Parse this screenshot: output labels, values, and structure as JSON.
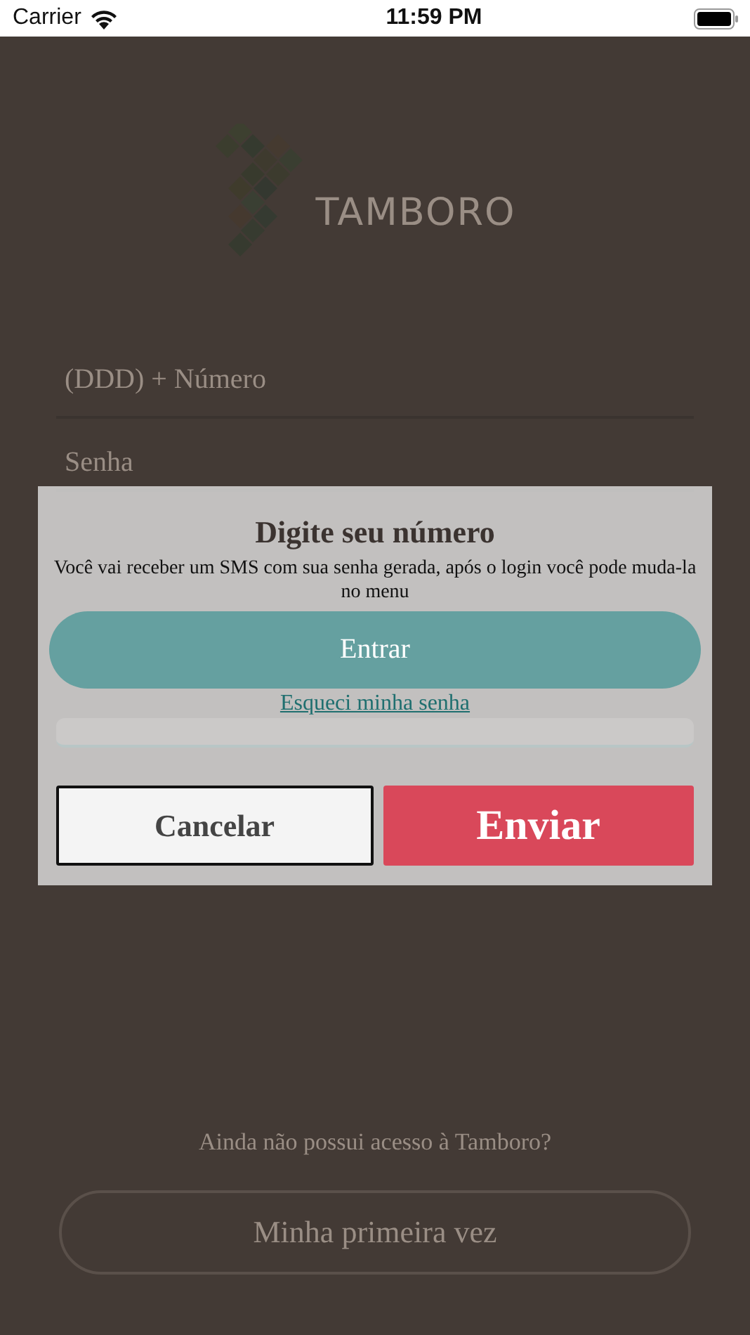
{
  "status_bar": {
    "carrier": "Carrier",
    "time": "11:59 PM"
  },
  "logo": {
    "wordmark": "TAMBORO"
  },
  "login_form": {
    "phone_field": {
      "placeholder": "(DDD) + Número"
    },
    "password_field": {
      "placeholder": "Senha"
    },
    "submit_button": "Entrar",
    "forgot_link": "Esqueci minha senha"
  },
  "signup": {
    "prompt": "Ainda não possui acesso à Tamboro?",
    "button": "Minha primeira vez"
  },
  "dialog": {
    "title": "Digite seu número",
    "message": "Você vai receber um SMS com sua senha gerada, após o login você pode muda-la no menu",
    "buttons": [
      {
        "label": "Cancelar",
        "kind": "secondary"
      },
      {
        "label": "Enviar",
        "kind": "primary"
      }
    ]
  }
}
